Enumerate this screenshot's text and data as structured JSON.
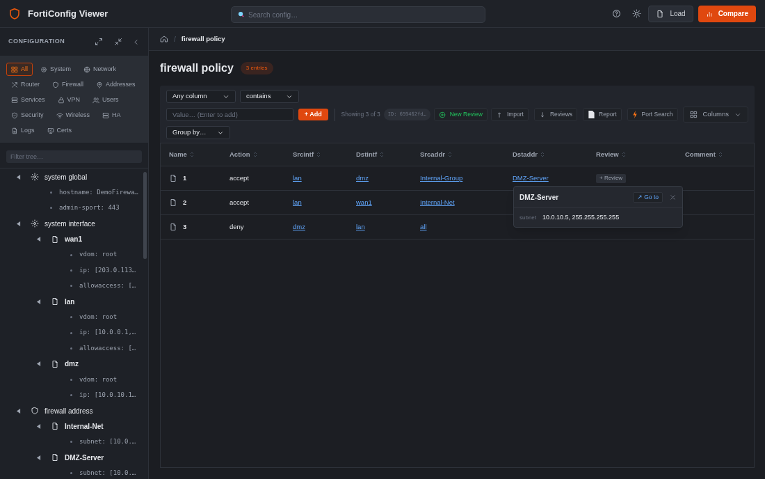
{
  "app": {
    "title": "FortiConfig Viewer",
    "search_placeholder": "Search config…",
    "load": "Load",
    "compare": "Compare"
  },
  "sidebar": {
    "heading": "CONFIGURATION",
    "categories": [
      {
        "label": "All",
        "selected": true
      },
      {
        "label": "System",
        "selected": false
      },
      {
        "label": "Network",
        "selected": false
      },
      {
        "label": "Router",
        "selected": false
      },
      {
        "label": "Firewall",
        "selected": false
      },
      {
        "label": "Addresses",
        "selected": false
      },
      {
        "label": "Services",
        "selected": false
      },
      {
        "label": "VPN",
        "selected": false
      },
      {
        "label": "Users",
        "selected": false
      },
      {
        "label": "Security",
        "selected": false
      },
      {
        "label": "Wireless",
        "selected": false
      },
      {
        "label": "HA",
        "selected": false
      },
      {
        "label": "Logs",
        "selected": false
      },
      {
        "label": "Certs",
        "selected": false
      }
    ],
    "filter_placeholder": "Filter tree…",
    "tree": [
      {
        "kind": "system",
        "label": "system global",
        "expanded": true,
        "children": [
          {
            "kind": "field",
            "label": "hostname: DemoFirewa…"
          },
          {
            "kind": "field",
            "label": "admin-sport: 443"
          }
        ]
      },
      {
        "kind": "system",
        "label": "system interface",
        "expanded": true,
        "children": [
          {
            "kind": "entry",
            "label": "wan1",
            "expanded": true,
            "children": [
              {
                "kind": "field",
                "label": "vdom: root"
              },
              {
                "kind": "field",
                "label": "ip: [203.0.113…"
              },
              {
                "kind": "field",
                "label": "allowaccess: […"
              }
            ]
          },
          {
            "kind": "entry",
            "label": "lan",
            "expanded": true,
            "children": [
              {
                "kind": "field",
                "label": "vdom: root"
              },
              {
                "kind": "field",
                "label": "ip: [10.0.0.1,…"
              },
              {
                "kind": "field",
                "label": "allowaccess: […"
              }
            ]
          },
          {
            "kind": "entry",
            "label": "dmz",
            "expanded": true,
            "children": [
              {
                "kind": "field",
                "label": "vdom: root"
              },
              {
                "kind": "field",
                "label": "ip: [10.0.10.1…"
              }
            ]
          }
        ]
      },
      {
        "kind": "firewall",
        "label": "firewall address",
        "expanded": true,
        "children": [
          {
            "kind": "entry",
            "label": "Internal-Net",
            "expanded": true,
            "children": [
              {
                "kind": "field",
                "label": "subnet: [10.0.…"
              }
            ]
          },
          {
            "kind": "entry",
            "label": "DMZ-Server",
            "expanded": true,
            "children": [
              {
                "kind": "field",
                "label": "subnet: [10.0.…"
              }
            ]
          }
        ]
      }
    ]
  },
  "breadcrumb": {
    "separator": "/",
    "current": "firewall policy"
  },
  "page": {
    "title": "firewall policy",
    "badge": "3 entries"
  },
  "filters": {
    "column": "Any column",
    "operator": "contains",
    "value_placeholder": "Value… (Enter to add)",
    "add": "+ Add",
    "showing": "Showing 3 of 3",
    "id": "ID: 659462fd…",
    "group_by": "Group by…"
  },
  "actions": [
    {
      "label": "New Review",
      "kind": "accent"
    },
    {
      "label": "Import",
      "kind": "plain"
    },
    {
      "label": "Reviews",
      "kind": "plain"
    },
    {
      "label": "Report",
      "kind": "plain"
    },
    {
      "label": "Port Search",
      "kind": "plain"
    }
  ],
  "columns_button": "Columns",
  "table": {
    "columns": [
      "Name",
      "Action",
      "Srcintf",
      "Dstintf",
      "Srcaddr",
      "Dstaddr",
      "Review",
      "Comment"
    ],
    "rows": [
      {
        "name": "1",
        "action": "accept",
        "srcintf": "lan",
        "dstintf": "dmz",
        "srcaddr": "Internal-Group",
        "dstaddr": "DMZ-Server",
        "review": "+ Review"
      },
      {
        "name": "2",
        "action": "accept",
        "srcintf": "lan",
        "dstintf": "wan1",
        "srcaddr": "Internal-Net"
      },
      {
        "name": "3",
        "action": "deny",
        "srcintf": "dmz",
        "dstintf": "lan",
        "srcaddr": "all"
      }
    ]
  },
  "popover": {
    "title": "DMZ-Server",
    "goto": "↗ Go to",
    "field": "subnet",
    "value": "10.0.10.5, 255.255.255.255"
  }
}
